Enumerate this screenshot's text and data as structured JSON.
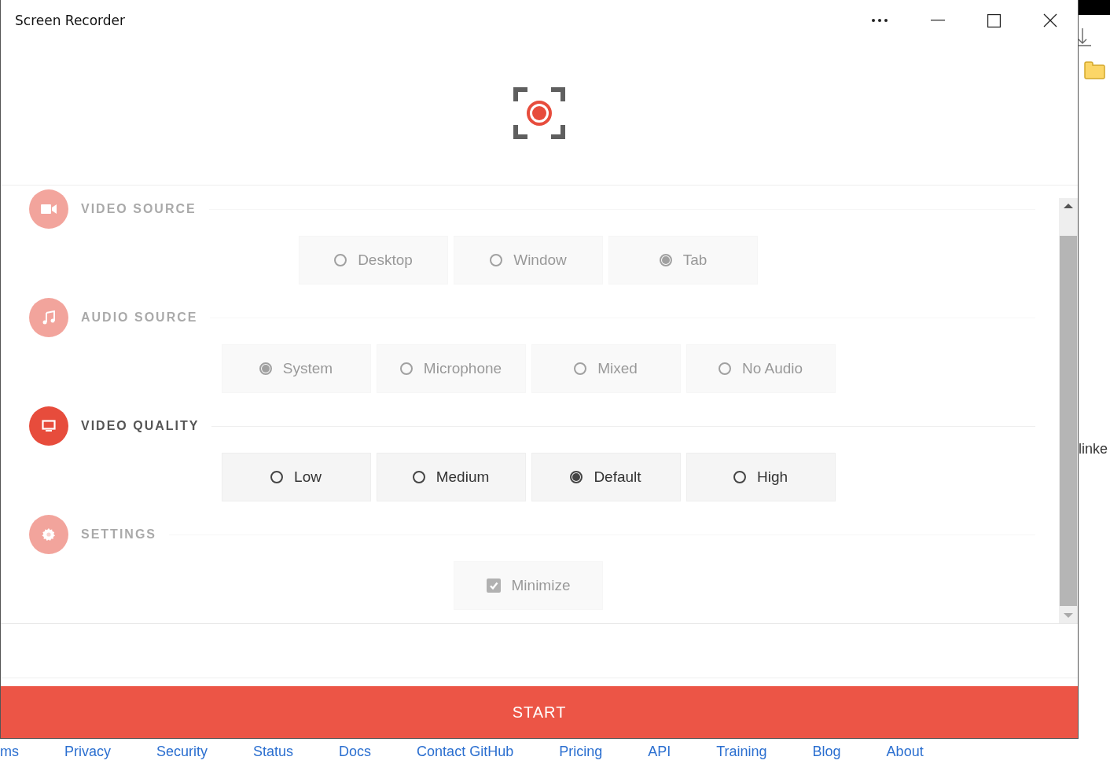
{
  "window": {
    "title": "Screen Recorder"
  },
  "sections": [
    {
      "title": "VIDEO SOURCE",
      "disabled": true,
      "options": [
        {
          "kind": "radio",
          "label": "Desktop",
          "selected": false
        },
        {
          "kind": "radio",
          "label": "Window",
          "selected": false
        },
        {
          "kind": "radio",
          "label": "Tab",
          "selected": true
        }
      ]
    },
    {
      "title": "AUDIO SOURCE",
      "disabled": true,
      "options": [
        {
          "kind": "radio",
          "label": "System",
          "selected": true
        },
        {
          "kind": "radio",
          "label": "Microphone",
          "selected": false
        },
        {
          "kind": "radio",
          "label": "Mixed",
          "selected": false
        },
        {
          "kind": "radio",
          "label": "No Audio",
          "selected": false
        }
      ]
    },
    {
      "title": "VIDEO QUALITY",
      "disabled": false,
      "options": [
        {
          "kind": "radio",
          "label": "Low",
          "selected": false
        },
        {
          "kind": "radio",
          "label": "Medium",
          "selected": false
        },
        {
          "kind": "radio",
          "label": "Default",
          "selected": true
        },
        {
          "kind": "radio",
          "label": "High",
          "selected": false
        }
      ]
    },
    {
      "title": "SETTINGS",
      "disabled": true,
      "options": [
        {
          "kind": "checkbox",
          "label": "Minimize",
          "checked": true
        }
      ]
    }
  ],
  "start_button": "START",
  "background": {
    "side_text": "linke",
    "footer_links": [
      "ms",
      "Privacy",
      "Security",
      "Status",
      "Docs",
      "Contact GitHub",
      "Pricing",
      "API",
      "Training",
      "Blog",
      "About"
    ]
  }
}
